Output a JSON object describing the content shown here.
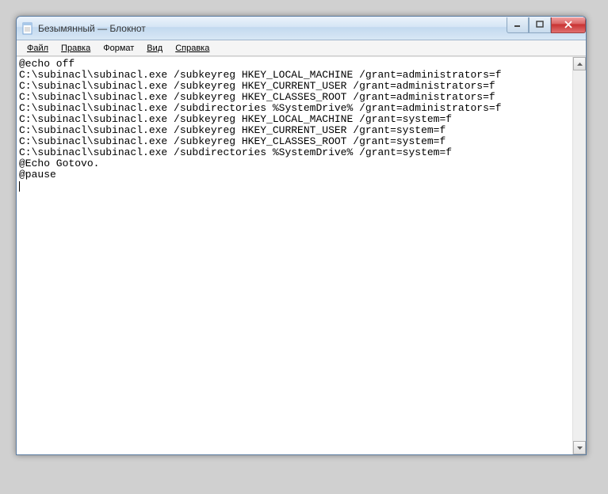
{
  "window": {
    "title": "Безымянный — Блокнот"
  },
  "menu": {
    "file": "Файл",
    "edit": "Правка",
    "format": "Формат",
    "view": "Вид",
    "help": "Справка"
  },
  "editor": {
    "content": "@echo off\nC:\\subinacl\\subinacl.exe /subkeyreg HKEY_LOCAL_MACHINE /grant=administrators=f\nC:\\subinacl\\subinacl.exe /subkeyreg HKEY_CURRENT_USER /grant=administrators=f\nC:\\subinacl\\subinacl.exe /subkeyreg HKEY_CLASSES_ROOT /grant=administrators=f\nC:\\subinacl\\subinacl.exe /subdirectories %SystemDrive% /grant=administrators=f\nC:\\subinacl\\subinacl.exe /subkeyreg HKEY_LOCAL_MACHINE /grant=system=f\nC:\\subinacl\\subinacl.exe /subkeyreg HKEY_CURRENT_USER /grant=system=f\nC:\\subinacl\\subinacl.exe /subkeyreg HKEY_CLASSES_ROOT /grant=system=f\nC:\\subinacl\\subinacl.exe /subdirectories %SystemDrive% /grant=system=f\n@Echo Gotovo.\n@pause"
  }
}
